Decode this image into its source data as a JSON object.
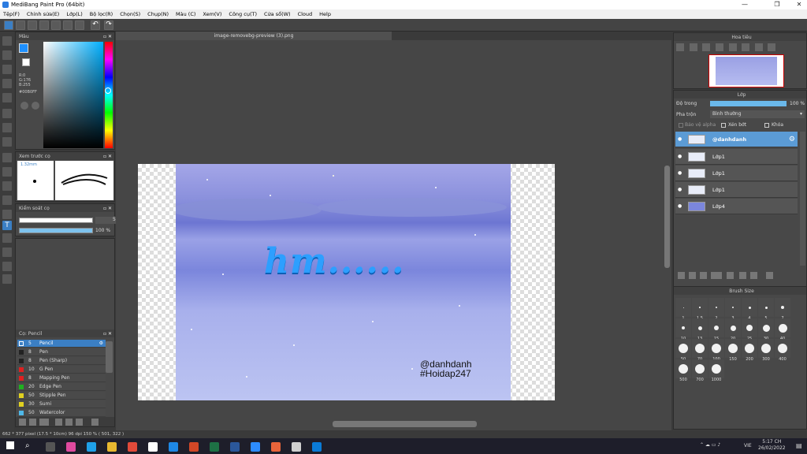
{
  "window": {
    "title": "MediBang Paint Pro (64bit)",
    "min": "—",
    "max": "❐",
    "close": "✕"
  },
  "menu": [
    "Tệp(F)",
    "Chỉnh sửa(E)",
    "Lớp(L)",
    "Bộ lọc(R)",
    "Chọn(S)",
    "Chụp(N)",
    "Màu (C)",
    "Xem(V)",
    "Công cụ(T)",
    "Cửa sổ(W)",
    "Cloud",
    "Help"
  ],
  "color_panel": {
    "title": "Màu",
    "r": "R:0",
    "g": "G:176",
    "b": "B:255",
    "hex": "#00B0FF"
  },
  "brush_preview": {
    "title": "Xem trước cọ",
    "size": "1.32mm"
  },
  "brush_control": {
    "title": "Kiểm soát cọ",
    "size_value": "5",
    "opacity_value": "100 %"
  },
  "brush_list": {
    "title": "Cọ: Pencil",
    "items": [
      {
        "size": "5",
        "name": "Pencil",
        "color": "#3b7fc4"
      },
      {
        "size": "8",
        "name": "Pen",
        "color": "#222222"
      },
      {
        "size": "8",
        "name": "Pen (Sharp)",
        "color": "#222222"
      },
      {
        "size": "10",
        "name": "G Pen",
        "color": "#e02020"
      },
      {
        "size": "8",
        "name": "Mapping Pen",
        "color": "#e02020"
      },
      {
        "size": "20",
        "name": "Edge Pen",
        "color": "#20b020"
      },
      {
        "size": "50",
        "name": "Stipple Pen",
        "color": "#e0d020"
      },
      {
        "size": "30",
        "name": "Sumi",
        "color": "#e0d020"
      },
      {
        "size": "50",
        "name": "Watercolor",
        "color": "#4fb8e8"
      }
    ]
  },
  "canvas": {
    "tab": "image-removebg-preview (3).png",
    "watermark_line1": "@danhdanh",
    "watermark_line2": "#Hoidap247",
    "lettering": "hm......"
  },
  "navigator": {
    "title": "Hoa tiêu"
  },
  "layers": {
    "title": "Lớp",
    "opacity_label": "Độ trong",
    "opacity_value": "100 %",
    "blend_label": "Pha trộn",
    "blend_value": "Bình thường",
    "protect_alpha": "Bảo vệ alpha",
    "clipping": "Xén bớt",
    "lock": "Khóa",
    "items": [
      "@danhdanh",
      "Lớp1",
      "Lớp1",
      "Lớp1",
      "Lớp4"
    ]
  },
  "brush_size": {
    "title": "Brush Size",
    "sizes": [
      "1",
      "1.5",
      "2",
      "3",
      "4",
      "5",
      "7",
      "10",
      "13",
      "15",
      "20",
      "25",
      "30",
      "40",
      "50",
      "70",
      "100",
      "150",
      "200",
      "300",
      "400",
      "500",
      "700",
      "1000"
    ]
  },
  "status": {
    "text": "662 * 377 pixel   (17.5 * 10cm)  96 dpi   150 %  ( 501, 322 )"
  },
  "taskbar": {
    "time": "5:17 CH",
    "date": "26/02/2022",
    "lang": "VIE"
  }
}
